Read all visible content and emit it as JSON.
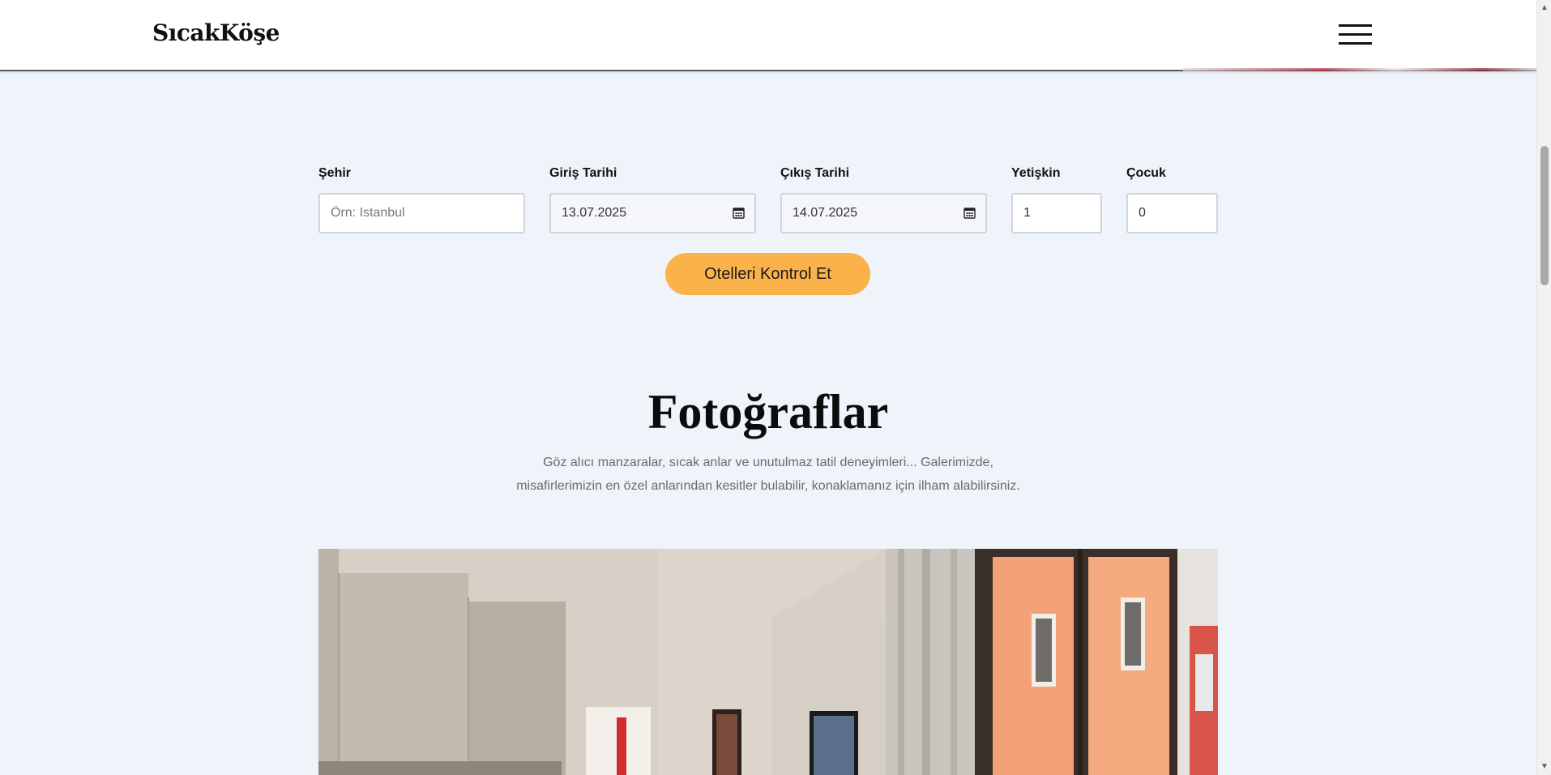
{
  "header": {
    "logo": "SıcakKöşe",
    "menu_icon": "hamburger-menu-icon"
  },
  "search": {
    "city_label": "Şehir",
    "city_placeholder": "Örn: Istanbul",
    "checkin_label": "Giriş Tarihi",
    "checkin_value": "13.07.2025",
    "checkout_label": "Çıkış Tarihi",
    "checkout_value": "14.07.2025",
    "adults_label": "Yetişkin",
    "adults_value": "1",
    "children_label": "Çocuk",
    "children_value": "0",
    "submit_label": "Otelleri Kontrol Et",
    "calendar_icon": "calendar-icon"
  },
  "photos": {
    "title": "Fotoğraflar",
    "description_line1": "Göz alıcı manzaralar, sıcak anlar ve unutulmaz tatil deneyimleri... Galerimizde,",
    "description_line2": "misafirlerimizin en özel anlarından kesitler bulabilir, konaklamanız için ilham alabilirsiniz."
  },
  "colors": {
    "background": "#eff3fa",
    "accent": "#fbb24a",
    "header_bg": "#ffffff"
  }
}
